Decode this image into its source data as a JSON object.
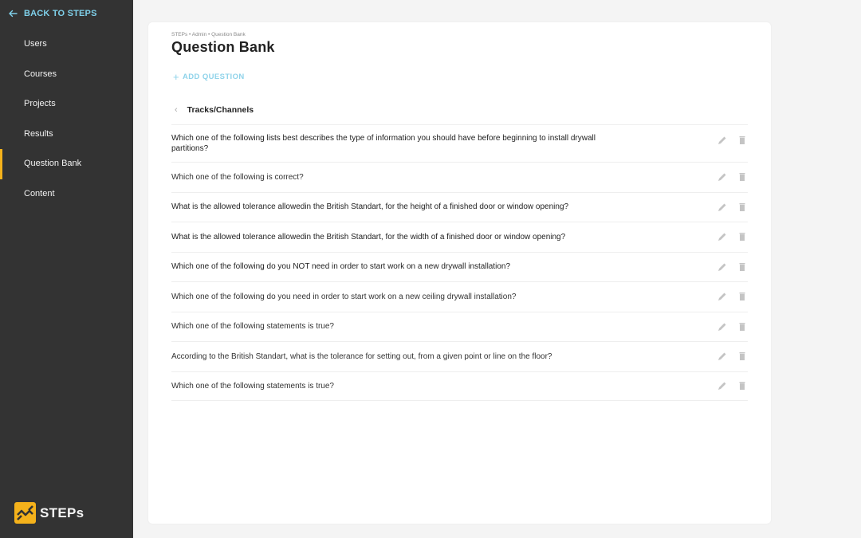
{
  "sidebar": {
    "back_label": "BACK TO STEPS",
    "items": [
      {
        "label": "Users",
        "active": false
      },
      {
        "label": "Courses",
        "active": false
      },
      {
        "label": "Projects",
        "active": false
      },
      {
        "label": "Results",
        "active": false
      },
      {
        "label": "Question Bank",
        "active": true
      },
      {
        "label": "Content",
        "active": false
      }
    ],
    "logo_text": "STEPs"
  },
  "header": {
    "breadcrumb": "STEPs • Admin • Question Bank",
    "title": "Question Bank",
    "add_button": "ADD QUESTION"
  },
  "section": {
    "label": "Tracks/Channels"
  },
  "questions": [
    "Which one of the following lists best describes the type of information you should have before beginning to install drywall partitions?",
    "Which one of the following is correct?",
    "What is the allowed tolerance allowedin the British Standart, for the height of a finished door or window opening?",
    "What is the allowed tolerance allowedin the British Standart, for the width of a finished door or window opening?",
    "Which one of the following do you NOT need in order to start work on a new drywall installation?",
    "Which one of the following do you need in order to start work on a new ceiling drywall installation?",
    "Which one of the following statements is true?",
    "According to the British Standart, what is the tolerance for setting out, from a given point or line on the floor?",
    "Which one of the following statements is true?"
  ],
  "colors": {
    "sidebar_bg": "#333333",
    "accent_active": "#f5b21b",
    "link": "#7fd0ea"
  }
}
